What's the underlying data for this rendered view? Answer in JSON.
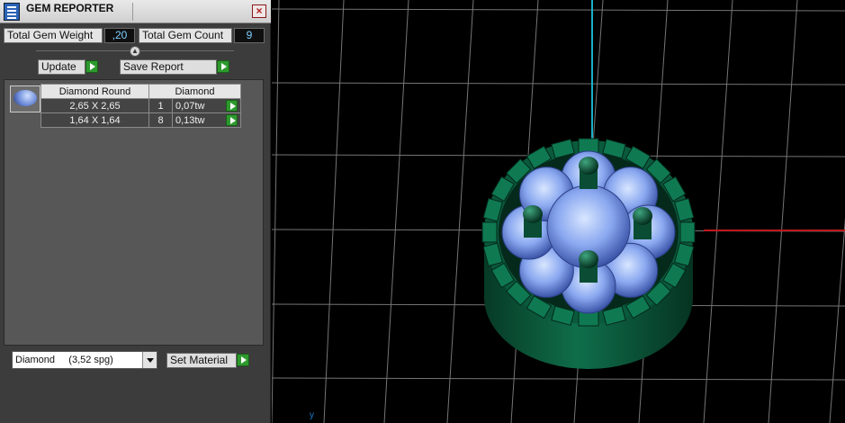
{
  "window": {
    "title": "GEM REPORTER",
    "close_symbol": "×"
  },
  "summary": {
    "weight_label": "Total Gem Weight",
    "weight_value": ",20",
    "count_label": "Total Gem Count",
    "count_value": "9"
  },
  "actions": {
    "update_label": "Update",
    "save_report_label": "Save Report"
  },
  "gem_table": {
    "headers": [
      "Diamond Round",
      "Diamond"
    ],
    "rows": [
      {
        "size": "2,65 X 2,65",
        "count": "1",
        "weight": "0,07tw"
      },
      {
        "size": "1,64 X 1,64",
        "count": "8",
        "weight": "0,13tw"
      }
    ]
  },
  "material": {
    "selected": "Diamond     (3,52 spg)",
    "set_label": "Set Material"
  },
  "viewport": {
    "axis_label": "y"
  },
  "colors": {
    "panel_bg": "#3c3c3c",
    "metal_green": "#0f6e4a",
    "gem_blue": "#8aa8f0",
    "grid_line": "#8a8a8a",
    "axis_red": "#c0181c",
    "axis_cyan": "#1ab0c8"
  },
  "icons": [
    "app-icon",
    "close-icon",
    "collapse-icon",
    "play-icon",
    "dropdown-arrow-icon"
  ]
}
